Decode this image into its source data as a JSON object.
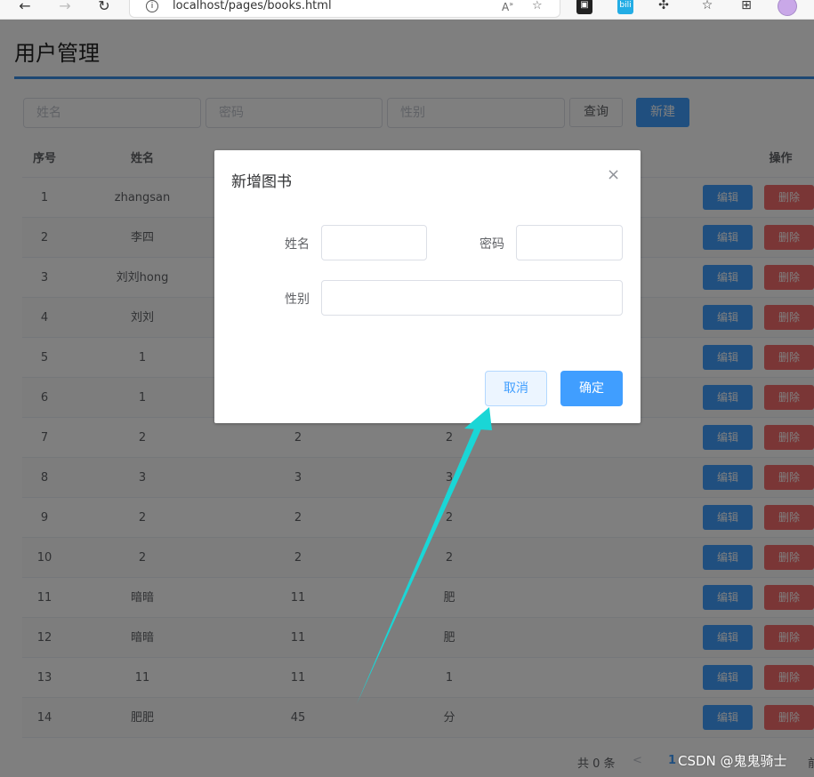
{
  "browser": {
    "url": "localhost/pages/books.html",
    "icons": [
      "back-icon",
      "forward-icon",
      "reload-icon",
      "info-icon",
      "read-aloud-icon",
      "add-favorite-icon",
      "extension-icon",
      "favorites-icon",
      "collections-icon",
      "profile-avatar"
    ]
  },
  "page": {
    "title": "用户管理",
    "search": {
      "name_placeholder": "姓名",
      "password_placeholder": "密码",
      "gender_placeholder": "性别",
      "query_label": "查询",
      "new_label": "新建"
    },
    "table": {
      "headers": {
        "index": "序号",
        "name": "姓名",
        "op": "操作"
      },
      "rows": [
        {
          "index": "1",
          "name": "zhangsan",
          "password": "",
          "gender": ""
        },
        {
          "index": "2",
          "name": "李四",
          "password": "",
          "gender": ""
        },
        {
          "index": "3",
          "name": "刘刘hong",
          "password": "",
          "gender": ""
        },
        {
          "index": "4",
          "name": "刘刘",
          "password": "",
          "gender": ""
        },
        {
          "index": "5",
          "name": "1",
          "password": "",
          "gender": ""
        },
        {
          "index": "6",
          "name": "1",
          "password": "",
          "gender": ""
        },
        {
          "index": "7",
          "name": "2",
          "password": "2",
          "gender": "2"
        },
        {
          "index": "8",
          "name": "3",
          "password": "3",
          "gender": "3"
        },
        {
          "index": "9",
          "name": "2",
          "password": "2",
          "gender": "2"
        },
        {
          "index": "10",
          "name": "2",
          "password": "2",
          "gender": "2"
        },
        {
          "index": "11",
          "name": "暗暗",
          "password": "11",
          "gender": "肥"
        },
        {
          "index": "12",
          "name": "暗暗",
          "password": "11",
          "gender": "肥"
        },
        {
          "index": "13",
          "name": "11",
          "password": "11",
          "gender": "1"
        },
        {
          "index": "14",
          "name": "肥肥",
          "password": "45",
          "gender": "分"
        }
      ],
      "edit_label": "编辑",
      "delete_label": "删除"
    },
    "pager": {
      "total": "共 0 条",
      "prev": "<",
      "current": "1",
      "trailing": "前"
    }
  },
  "dialog": {
    "title": "新增图书",
    "close": "×",
    "name_label": "姓名",
    "password_label": "密码",
    "gender_label": "性别",
    "cancel_label": "取消",
    "ok_label": "确定"
  },
  "watermark": "CSDN @鬼鬼骑士",
  "colors": {
    "primary": "#409eff",
    "danger": "#f56c6c",
    "arrow": "#1ad6d6",
    "title_line": "#3a8ee6"
  }
}
